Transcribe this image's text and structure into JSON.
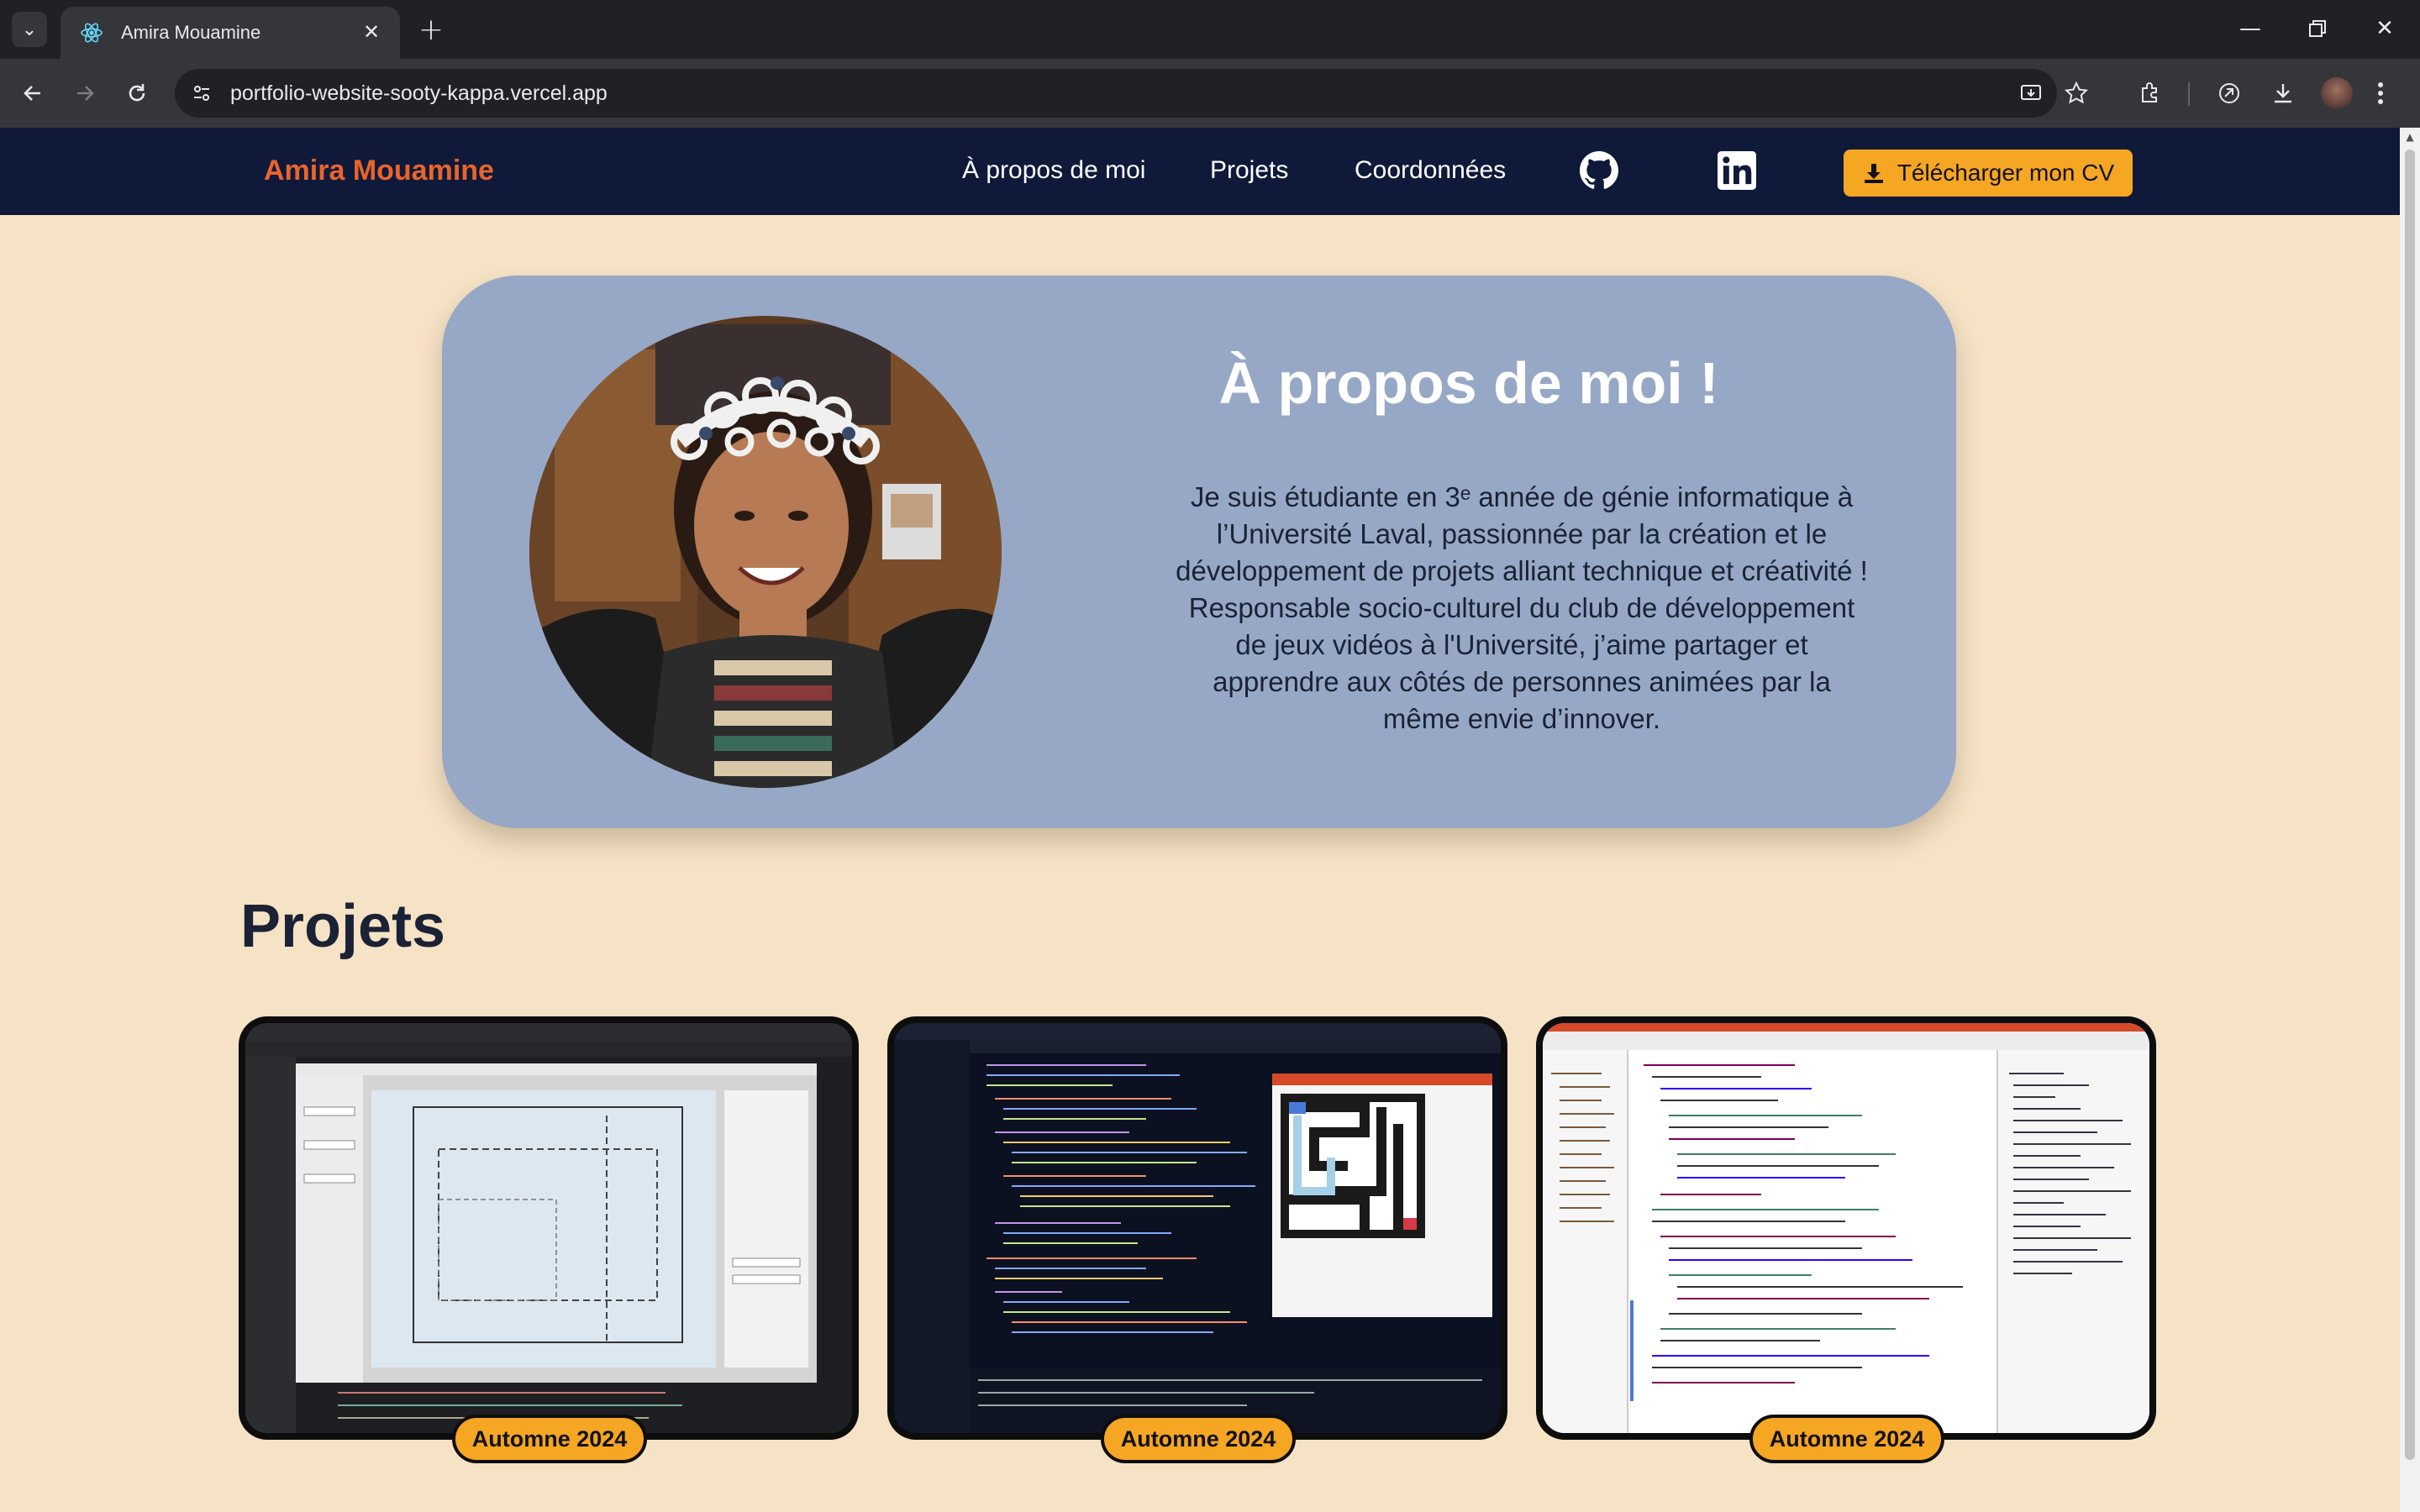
{
  "browser": {
    "tab_title": "Amira Mouamine",
    "url": "portfolio-website-sooty-kappa.vercel.app",
    "icons": [
      "tab-search-icon",
      "react-favicon-icon",
      "close-icon",
      "plus-icon",
      "minimize-icon",
      "restore-icon",
      "close-window-icon",
      "back-icon",
      "forward-icon",
      "reload-icon",
      "site-info-icon",
      "install-app-icon",
      "star-icon",
      "extensions-icon",
      "performance-icon",
      "download-icon",
      "profile-avatar",
      "menu-icon"
    ]
  },
  "site": {
    "brand": "Amira Mouamine",
    "nav": {
      "about": "À propos de moi",
      "projects": "Projets",
      "contact": "Coordonnées"
    },
    "cv_button": "Télécharger mon CV",
    "colors": {
      "nav_bg": "#0f1a3a",
      "brand": "#e9642c",
      "accent": "#f5a623",
      "page_bg": "#f6e2c5",
      "card_bg": "#96a8c6"
    }
  },
  "about": {
    "title": "À propos de moi !",
    "text": "Je suis étudiante en 3ᵉ année de génie informatique à l’Université Laval, passionnée par la création et le développement de projets alliant technique et créativité ! Responsable socio-culturel du club de développement de jeux vidéos à l'Université, j’aime partager et apprendre aux côtés de personnes animées par la même envie d’innover."
  },
  "projects": {
    "title": "Projets",
    "items": [
      {
        "season": "Automne 2024"
      },
      {
        "season": "Automne 2024"
      },
      {
        "season": "Automne 2024"
      }
    ]
  }
}
